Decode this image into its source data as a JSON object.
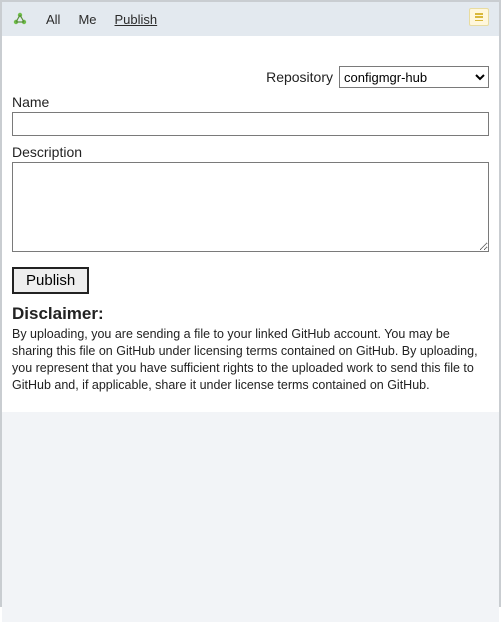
{
  "topbar": {
    "tabs": [
      {
        "label": "All"
      },
      {
        "label": "Me"
      },
      {
        "label": "Publish"
      }
    ],
    "active_tab_index": 2
  },
  "form": {
    "repository_label": "Repository",
    "repository_selected": "configmgr-hub",
    "repository_options": [
      "configmgr-hub"
    ],
    "name_label": "Name",
    "name_value": "",
    "description_label": "Description",
    "description_value": "",
    "publish_button": "Publish"
  },
  "disclaimer": {
    "heading": "Disclaimer:",
    "body": "By uploading, you are sending a file to your linked GitHub account. You may be sharing this file on GitHub under licensing terms contained on GitHub. By uploading, you represent that you have sufficient rights to the uploaded work to send this file to GitHub and, if applicable, share it under license terms contained on GitHub."
  }
}
